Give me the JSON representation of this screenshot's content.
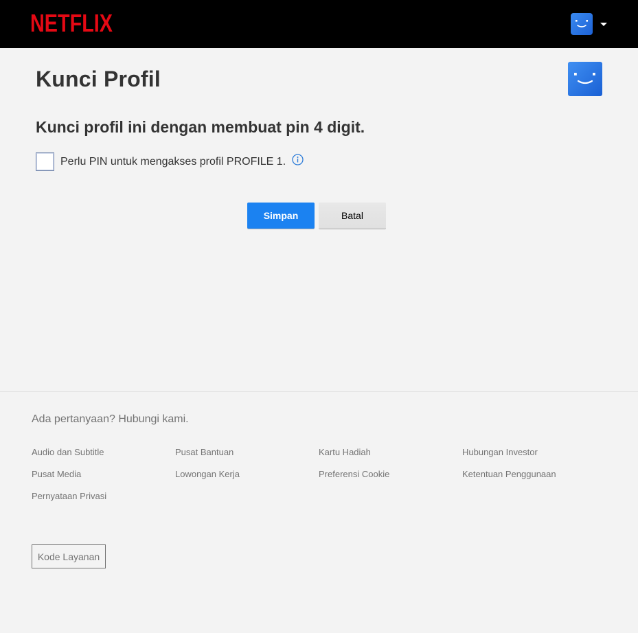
{
  "header": {
    "logo_text": "NETFLIX",
    "brand_color": "#e50914",
    "avatar_icon": "smiley-avatar-icon",
    "avatar_color": "#2a79e4",
    "dropdown_icon": "caret-down-icon"
  },
  "main": {
    "title": "Kunci Profil",
    "subtitle": "Kunci profil ini dengan membuat pin 4 digit.",
    "pin_checkbox_label": "Perlu PIN untuk mengakses profil PROFILE 1.",
    "pin_checkbox_checked": false,
    "info_icon": "info-icon",
    "save_label": "Simpan",
    "cancel_label": "Batal",
    "accent_color": "#1b82f1"
  },
  "footer": {
    "contact_text": "Ada pertanyaan? Hubungi kami.",
    "links": [
      "Audio dan Subtitle",
      "Pusat Bantuan",
      "Kartu Hadiah",
      "Hubungan Investor",
      "Pusat Media",
      "Lowongan Kerja",
      "Preferensi Cookie",
      "Ketentuan Penggunaan",
      "Pernyataan Privasi"
    ],
    "service_code_label": "Kode Layanan"
  }
}
